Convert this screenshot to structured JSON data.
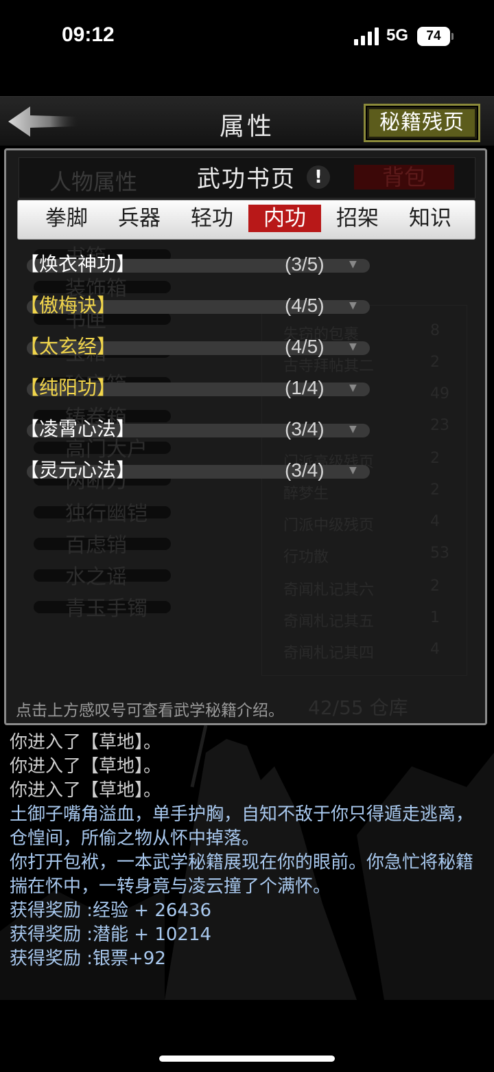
{
  "status_bar": {
    "time": "09:12",
    "network": "5G",
    "battery": "74"
  },
  "header": {
    "title": "属性",
    "manual_pages_label": "秘籍残页"
  },
  "background_panel": {
    "tab_attributes": "人物属性",
    "tab_bag": "背包",
    "items": [
      {
        "name": "书箱"
      },
      {
        "name": "装饰箱"
      },
      {
        "name": "书匣"
      },
      {
        "name": "宝箱"
      },
      {
        "name": "珍宝箱"
      },
      {
        "name": "铸卷箱"
      },
      {
        "name": "高门大户"
      },
      {
        "name": "两断刀"
      },
      {
        "name": "独行幽铠"
      },
      {
        "name": "百虑销"
      },
      {
        "name": "水之谣"
      },
      {
        "name": "青玉手镯"
      }
    ],
    "right_items": [
      {
        "name": "失窃的包裹",
        "count": "8"
      },
      {
        "name": "古寺拜帖其二",
        "count": "2"
      },
      {
        "name": "",
        "count": "49"
      },
      {
        "name": "",
        "count": "23"
      },
      {
        "name": "门派高级残页",
        "count": "2"
      },
      {
        "name": "醉梦生",
        "count": "2"
      },
      {
        "name": "门派中级残页",
        "count": "4"
      },
      {
        "name": "行功散",
        "count": "53"
      },
      {
        "name": "奇闻札记其六",
        "count": "2"
      },
      {
        "name": "奇闻札记其五",
        "count": "1"
      },
      {
        "name": "奇闻札记其四",
        "count": "4"
      }
    ],
    "storage": "42/55 仓库"
  },
  "book_pages": {
    "title": "武功书页",
    "info_icon": "!",
    "tabs": [
      {
        "label": "拳脚",
        "active": false
      },
      {
        "label": "兵器",
        "active": false
      },
      {
        "label": "轻功",
        "active": false
      },
      {
        "label": "内功",
        "active": true
      },
      {
        "label": "招架",
        "active": false
      },
      {
        "label": "知识",
        "active": false
      }
    ],
    "skills": [
      {
        "name": "【焕衣神功】",
        "progress": "(3/5)",
        "color": "#ffffff"
      },
      {
        "name": "【傲梅诀】",
        "progress": "(4/5)",
        "color": "#f2d64b"
      },
      {
        "name": "【太玄经】",
        "progress": "(4/5)",
        "color": "#f2d64b"
      },
      {
        "name": "【纯阳功】",
        "progress": "(1/4)",
        "color": "#f2d64b"
      },
      {
        "name": "【凌霄心法】",
        "progress": "(3/4)",
        "color": "#ffffff"
      },
      {
        "name": "【灵元心法】",
        "progress": "(3/4)",
        "color": "#ffffff"
      }
    ],
    "hint": "点击上方感叹号可查看武学秘籍介绍。"
  },
  "log": [
    {
      "text": "你进入了【草地】。",
      "style": "white"
    },
    {
      "text": "你进入了【草地】。",
      "style": "white"
    },
    {
      "text": "你进入了【草地】。",
      "style": "white"
    },
    {
      "text": "土御子嘴角溢血，单手护胸，自知不敌于你只得遁走逃离，仓惶间，所偷之物从怀中掉落。",
      "style": "blue"
    },
    {
      "text": "你打开包袱，一本武学秘籍展现在你的眼前。你急忙将秘籍揣在怀中，一转身竟与凌云撞了个满怀。",
      "style": "blue"
    },
    {
      "text": "获得奖励 :经验 + 26436",
      "style": "blue"
    },
    {
      "text": "获得奖励 :潜能 + 10214",
      "style": "blue"
    },
    {
      "text": "获得奖励 :银票+92",
      "style": "blue"
    }
  ]
}
